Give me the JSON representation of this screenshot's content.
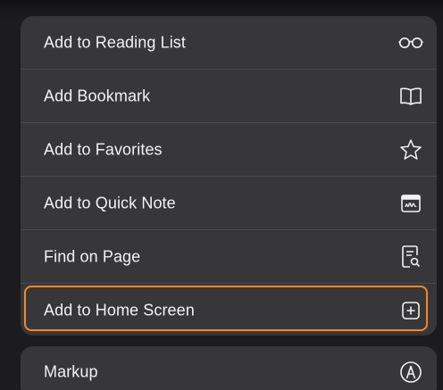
{
  "menu": {
    "items": [
      {
        "label": "Add to Reading List",
        "icon": "glasses-icon"
      },
      {
        "label": "Add Bookmark",
        "icon": "book-icon"
      },
      {
        "label": "Add to Favorites",
        "icon": "star-icon"
      },
      {
        "label": "Add to Quick Note",
        "icon": "quick-note-icon"
      },
      {
        "label": "Find on Page",
        "icon": "find-on-page-icon"
      },
      {
        "label": "Add to Home Screen",
        "icon": "plus-square-icon"
      }
    ],
    "secondary": [
      {
        "label": "Markup",
        "icon": "markup-pen-icon"
      }
    ]
  },
  "highlight": {
    "target": "Add to Home Screen",
    "color": "#f0882f"
  },
  "colors": {
    "background": "#1c1c1e",
    "menu_fill": "#373739",
    "text": "#f2f2f4",
    "divider": "#4a4a4d"
  }
}
